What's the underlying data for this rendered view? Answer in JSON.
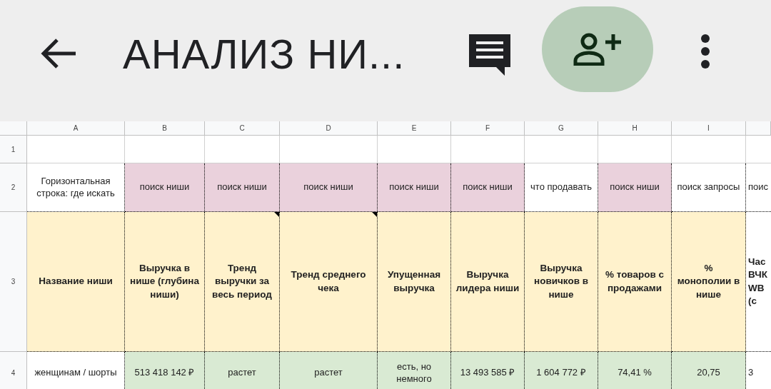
{
  "app_bar": {
    "title": "АНАЛИЗ НИ..."
  },
  "sheet": {
    "columns": [
      "A",
      "B",
      "C",
      "D",
      "E",
      "F",
      "G",
      "H",
      "I"
    ],
    "rows": [
      {
        "number": "1",
        "cells": []
      },
      {
        "number": "2",
        "cells": [
          {
            "text": "Горизонтальная строка: где искать"
          },
          {
            "text": "поиск ниши",
            "color": "#ead1dc"
          },
          {
            "text": "поиск ниши",
            "color": "#ead1dc"
          },
          {
            "text": "поиск ниши",
            "color": "#ead1dc"
          },
          {
            "text": "поиск ниши",
            "color": "#ead1dc"
          },
          {
            "text": "поиск ниши",
            "color": "#ead1dc"
          },
          {
            "text": "что продавать"
          },
          {
            "text": "поиск ниши",
            "color": "#ead1dc"
          },
          {
            "text": "поиск запросы"
          },
          {
            "text": "поис"
          }
        ]
      },
      {
        "number": "3",
        "cells": [
          {
            "text": "Название ниши",
            "color": "#fff2cc",
            "bold": true
          },
          {
            "text": "Выручка в нише (глубина ниши)",
            "color": "#fff2cc",
            "bold": true
          },
          {
            "text": "Тренд выручки за весь период",
            "color": "#fff2cc",
            "bold": true,
            "note": true
          },
          {
            "text": "Тренд среднего чека",
            "color": "#fff2cc",
            "bold": true,
            "note": true
          },
          {
            "text": "Упущенная выручка",
            "color": "#fff2cc",
            "bold": true
          },
          {
            "text": "Выручка лидера ниши",
            "color": "#fff2cc",
            "bold": true
          },
          {
            "text": "Выручка новичков в нише",
            "color": "#fff2cc",
            "bold": true
          },
          {
            "text": "% товаров с продажами",
            "color": "#fff2cc",
            "bold": true
          },
          {
            "text": "% монополии в нише",
            "color": "#fff2cc",
            "bold": true
          },
          {
            "text": "Час ВЧК WB (с",
            "bold": true
          }
        ]
      },
      {
        "number": "4",
        "cells": [
          {
            "text": "женщинам / шорты"
          },
          {
            "text": "513 418 142 ₽",
            "color": "#d9ead3"
          },
          {
            "text": "растет",
            "color": "#d9ead3"
          },
          {
            "text": "растет",
            "color": "#d9ead3"
          },
          {
            "text": "есть, но немного",
            "color": "#d9ead3"
          },
          {
            "text": "13 493 585 ₽",
            "color": "#d9ead3"
          },
          {
            "text": "1 604 772 ₽",
            "color": "#d9ead3"
          },
          {
            "text": "74,41 %",
            "color": "#d9ead3"
          },
          {
            "text": "20,75",
            "color": "#d9ead3"
          },
          {
            "text": "3"
          }
        ]
      }
    ]
  }
}
